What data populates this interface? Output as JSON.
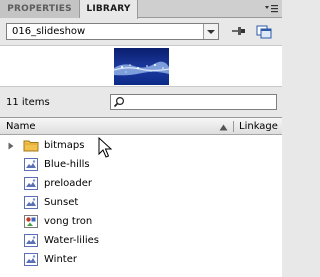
{
  "tabs": [
    {
      "label": "PROPERTIES",
      "active": false
    },
    {
      "label": "LIBRARY",
      "active": true
    }
  ],
  "library": {
    "document": "016_slideshow",
    "item_count": "11 items",
    "search": {
      "value": "",
      "placeholder": ""
    },
    "columns": {
      "name": "Name",
      "linkage": "Linkage"
    },
    "items": [
      {
        "label": "bitmaps",
        "type": "folder",
        "icon": "folder-icon"
      },
      {
        "label": "Blue-hills",
        "type": "bitmap",
        "icon": "bitmap-icon"
      },
      {
        "label": "preloader",
        "type": "bitmap",
        "icon": "bitmap-icon"
      },
      {
        "label": "Sunset",
        "type": "bitmap",
        "icon": "bitmap-icon"
      },
      {
        "label": "vong tron",
        "type": "graphic",
        "icon": "graphic-symbol-icon"
      },
      {
        "label": "Water-lilies",
        "type": "bitmap",
        "icon": "bitmap-icon"
      },
      {
        "label": "Winter",
        "type": "bitmap",
        "icon": "bitmap-icon"
      }
    ]
  },
  "colors": {
    "panel_bg": "#e8e8e8",
    "tab_inactive": "#c4c4c4",
    "folder": "#f2c14e",
    "bitmap_icon": "#5a6fb4",
    "graphic_icon": "#c0392b"
  }
}
